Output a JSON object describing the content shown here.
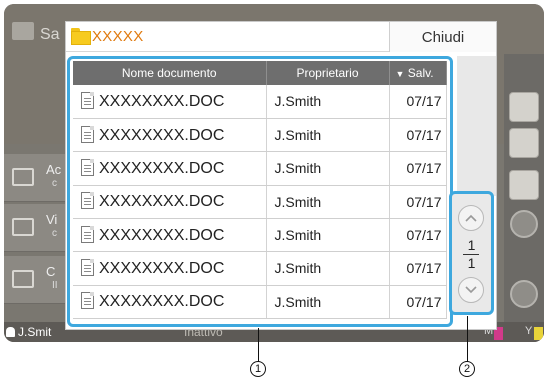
{
  "background": {
    "title_fragment": "Sa",
    "side_buttons": [
      {
        "label": "Ac",
        "sub": "c"
      },
      {
        "label": "Vi",
        "sub": "c"
      },
      {
        "label": "C",
        "sub": "II"
      }
    ],
    "status_user": "J.Smit",
    "status_text": "Inattivo",
    "ink_labels": [
      "M",
      "Y"
    ]
  },
  "dialog": {
    "folder_name": "XXXXX",
    "close_label": "Chiudi",
    "columns": {
      "name": "Nome documento",
      "owner": "Proprietario",
      "sort_indicator": "▼",
      "saved": "Salv."
    },
    "rows": [
      {
        "name": "XXXXXXXX.DOC",
        "owner": "J.Smith",
        "date": "07/17"
      },
      {
        "name": "XXXXXXXX.DOC",
        "owner": "J.Smith",
        "date": "07/17"
      },
      {
        "name": "XXXXXXXX.DOC",
        "owner": "J.Smith",
        "date": "07/17"
      },
      {
        "name": "XXXXXXXX.DOC",
        "owner": "J.Smith",
        "date": "07/17"
      },
      {
        "name": "XXXXXXXX.DOC",
        "owner": "J.Smith",
        "date": "07/17"
      },
      {
        "name": "XXXXXXXX.DOC",
        "owner": "J.Smith",
        "date": "07/17"
      },
      {
        "name": "XXXXXXXX.DOC",
        "owner": "J.Smith",
        "date": "07/17"
      }
    ],
    "pager": {
      "current": "1",
      "total": "1",
      "up_icon": "chevron-up-icon",
      "down_icon": "chevron-down-icon"
    }
  },
  "callouts": {
    "list": "1",
    "pager": "2"
  },
  "colors": {
    "accent_frame": "#3ea8de",
    "folder_name": "#e07a0f",
    "header_bg": "#6e6e6e",
    "folder_icon": "#f7cb1f"
  }
}
